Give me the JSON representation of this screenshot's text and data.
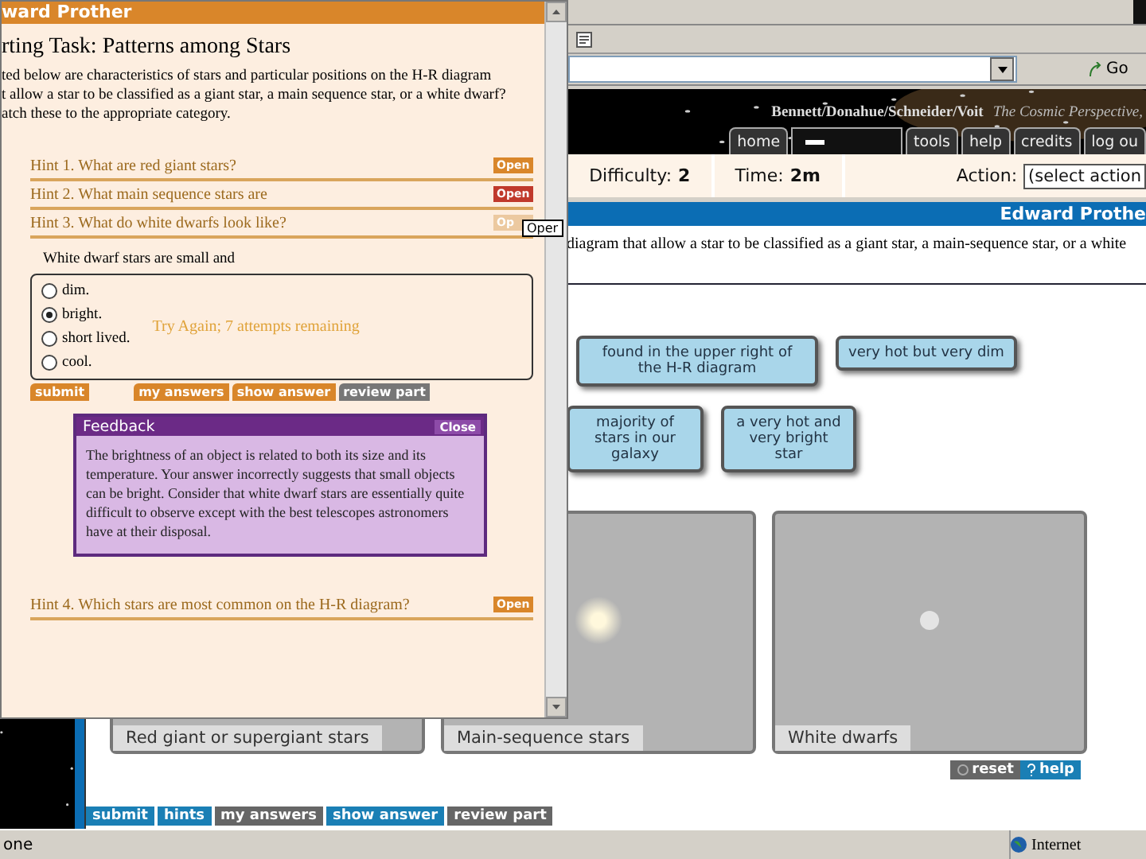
{
  "browser": {
    "go": "Go"
  },
  "header": {
    "authors": "Bennett/Donahue/Schneider/Voit",
    "book": "The Cosmic Perspective,",
    "tabs": [
      {
        "kind": "link",
        "label": "home"
      },
      {
        "kind": "menu"
      },
      {
        "kind": "link",
        "label": "tools"
      },
      {
        "kind": "link",
        "label": "help"
      },
      {
        "kind": "link",
        "label": "credits"
      },
      {
        "kind": "link",
        "label": "log ou"
      }
    ]
  },
  "info": {
    "difficulty_label": "Difficulty:",
    "difficulty": "2",
    "time_label": "Time:",
    "time": "2m",
    "action_label": "Action:",
    "action": "(select action"
  },
  "user_bar": "Edward Prothe",
  "instructions": "diagram that allow a star to be classified as a giant star, a main-sequence star, or a white",
  "cards": [
    [
      {
        "text": "found in the upper right of the H-R diagram"
      },
      {
        "text": "very hot but very dim"
      }
    ],
    [
      {
        "text": "majority of stars in our galaxy"
      },
      {
        "text": "a very hot and very bright star"
      }
    ]
  ],
  "bins": [
    {
      "label": "Red giant or supergiant stars",
      "kind": "none"
    },
    {
      "label": "Main-sequence stars",
      "kind": "large"
    },
    {
      "label": "White dwarfs",
      "kind": "small"
    }
  ],
  "bin_buttons": [
    {
      "kind": "reset",
      "label": "reset"
    },
    {
      "kind": "help",
      "label": "help"
    }
  ],
  "bottom_buttons": [
    {
      "label": "submit",
      "disabled": false
    },
    {
      "label": "hints",
      "disabled": false
    },
    {
      "label": "my answers",
      "disabled": true
    },
    {
      "label": "show answer",
      "disabled": false
    },
    {
      "label": "review part",
      "disabled": true
    }
  ],
  "status_bar": {
    "text": "one",
    "zone": "Internet"
  },
  "popup": {
    "title": "ward Prother",
    "heading": "rting Task: Patterns among Stars",
    "intro": [
      "ted below are characteristics of stars and particular positions on the H-R diagram",
      "t allow a star to be classified as a giant star, a main sequence star, or a white dwarf?",
      "atch these to the appropriate category."
    ],
    "hints": [
      {
        "label": "Hint 1. What are red giant stars?",
        "button": "Open",
        "kind": "normal"
      },
      {
        "label": "Hint 2. What main sequence stars are",
        "button": "Open",
        "kind": "visited"
      },
      {
        "label": "Hint 3. What do white dwarfs look like?",
        "button": "Op",
        "kind": "pressed",
        "tooltip": "Oper",
        "question": {
          "prompt": "White dwarf stars are small and",
          "options": [
            {
              "label": "dim.",
              "selected": false
            },
            {
              "label": "bright.",
              "selected": true
            },
            {
              "label": "short lived.",
              "selected": false
            },
            {
              "label": "cool.",
              "selected": false
            }
          ],
          "message": "Try Again; 7 attempts remaining",
          "buttons": [
            {
              "label": "submit",
              "disabled": false
            },
            {
              "label": "my answers",
              "disabled": false
            },
            {
              "label": "show answer",
              "disabled": false
            },
            {
              "label": "review part",
              "disabled": true
            }
          ],
          "feedback": {
            "title": "Feedback",
            "close": "Close",
            "text": "The brightness of an object is related to both its size and its temperature. Your answer incorrectly suggests that small objects can be bright. Consider that white dwarf stars are essentially quite difficult to observe except with the best telescopes astronomers have at their disposal."
          }
        }
      },
      {
        "label": "Hint 4. Which stars are most common on the H-R diagram?",
        "button": "Open",
        "kind": "normal"
      }
    ]
  }
}
